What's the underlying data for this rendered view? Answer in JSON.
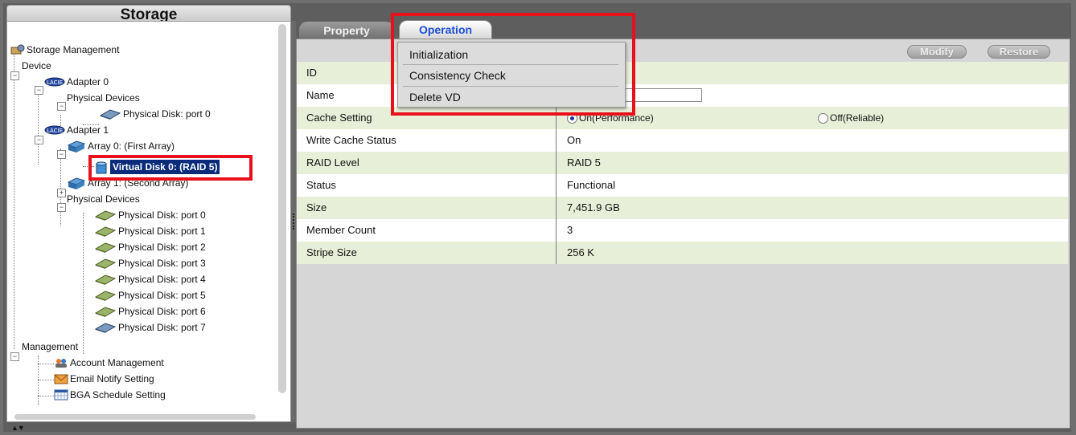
{
  "left": {
    "title": "Storage",
    "tree": [
      {
        "label": "Storage Management",
        "icon": "storage-management-icon"
      },
      {
        "label": "Device"
      },
      {
        "label": "Adapter 0",
        "icon": "adapter-icon"
      },
      {
        "label": "Physical Devices"
      },
      {
        "label": "Physical Disk: port 0",
        "icon": "physical-disk-icon"
      },
      {
        "label": "Adapter 1",
        "icon": "adapter-icon"
      },
      {
        "label": "Array 0: (First Array)",
        "icon": "array-icon"
      },
      {
        "label": "Virtual Disk 0: (RAID 5)",
        "icon": "virtual-disk-icon",
        "selected": true
      },
      {
        "label": "Array 1: (Second Array)",
        "icon": "array-icon"
      },
      {
        "label": "Physical Devices"
      },
      {
        "label": "Physical Disk: port 0",
        "icon": "physical-disk-icon"
      },
      {
        "label": "Physical Disk: port 1",
        "icon": "physical-disk-icon"
      },
      {
        "label": "Physical Disk: port 2",
        "icon": "physical-disk-icon"
      },
      {
        "label": "Physical Disk: port 3",
        "icon": "physical-disk-icon"
      },
      {
        "label": "Physical Disk: port 4",
        "icon": "physical-disk-icon"
      },
      {
        "label": "Physical Disk: port 5",
        "icon": "physical-disk-icon"
      },
      {
        "label": "Physical Disk: port 6",
        "icon": "physical-disk-icon"
      },
      {
        "label": "Physical Disk: port 7",
        "icon": "physical-disk-icon"
      },
      {
        "label": "Management"
      },
      {
        "label": "Account Management",
        "icon": "account-icon"
      },
      {
        "label": "Email Notify Setting",
        "icon": "email-icon"
      },
      {
        "label": "BGA Schedule Setting",
        "icon": "calendar-icon"
      }
    ]
  },
  "tabs": {
    "property": "Property",
    "operation": "Operation"
  },
  "buttons": {
    "modify": "Modify",
    "restore": "Restore"
  },
  "menu": {
    "items": [
      "Initialization",
      "Consistency Check",
      "Delete VD"
    ]
  },
  "table": {
    "rows": [
      {
        "key": "ID",
        "value": ""
      },
      {
        "key": "Name",
        "value": ""
      },
      {
        "key": "Cache Setting",
        "value": ""
      },
      {
        "key": "Write Cache Status",
        "value": "On"
      },
      {
        "key": "RAID Level",
        "value": "RAID 5"
      },
      {
        "key": "Status",
        "value": "Functional"
      },
      {
        "key": "Size",
        "value": "7,451.9 GB"
      },
      {
        "key": "Member Count",
        "value": "3"
      },
      {
        "key": "Stripe Size",
        "value": "256 K"
      }
    ],
    "cache_options": {
      "on": "On(Performance)",
      "off": "Off(Reliable)"
    }
  },
  "colors": {
    "highlight": "#e8101a",
    "selection": "#0a2b7a",
    "alt_row": "#e8efd8",
    "tab_active_text": "#1d4fd6"
  }
}
